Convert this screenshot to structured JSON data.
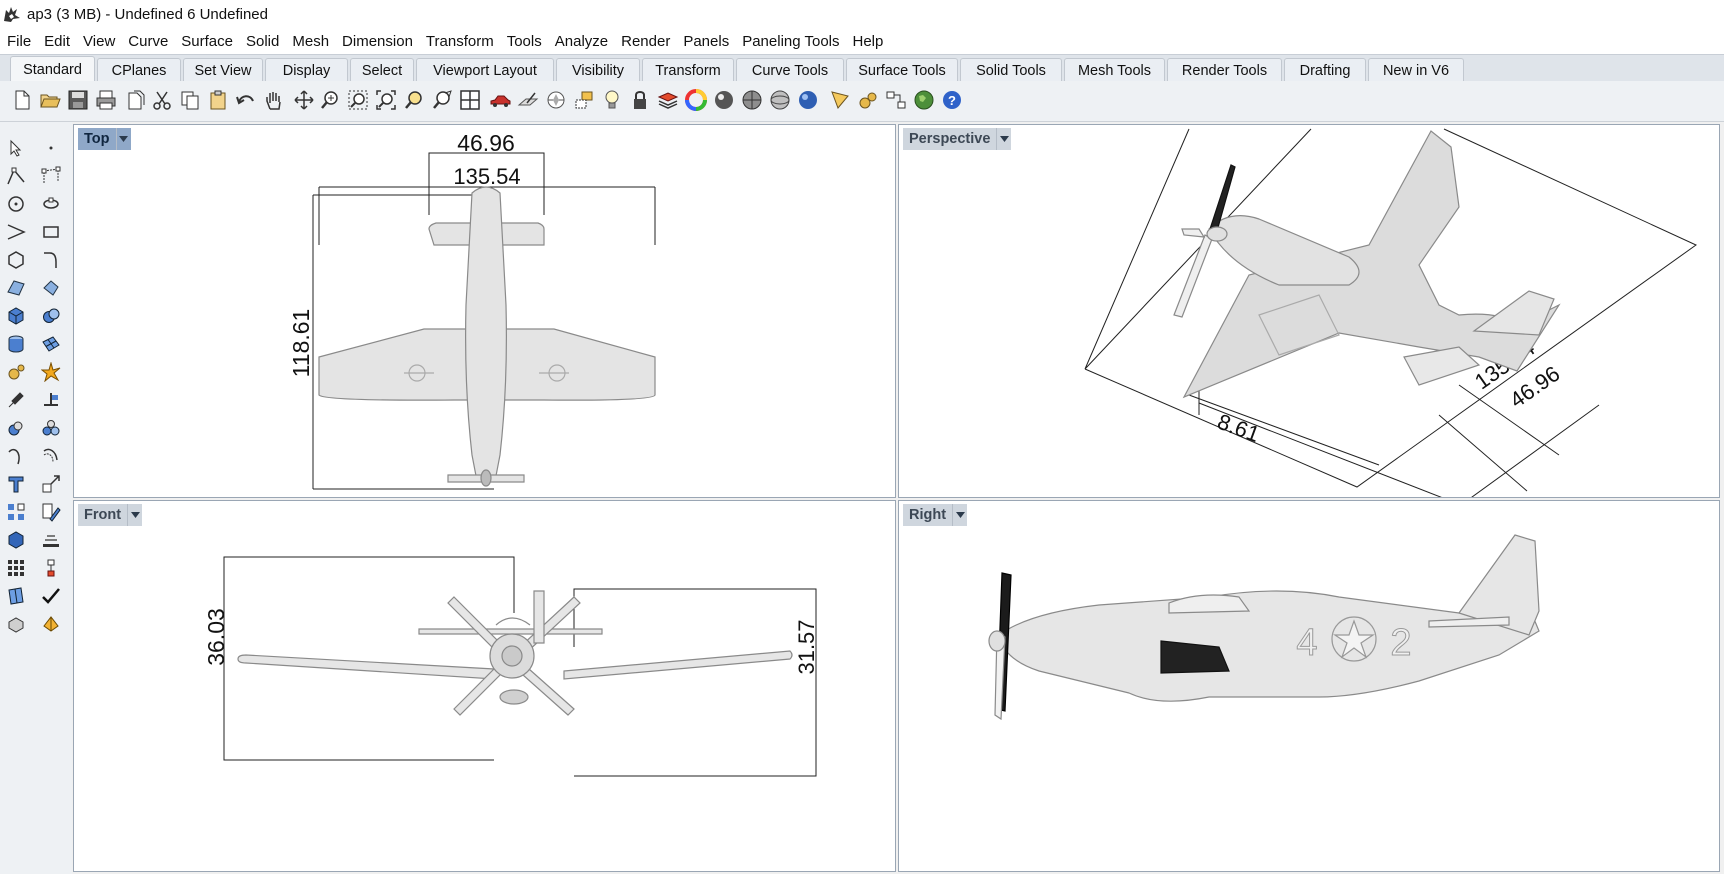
{
  "window": {
    "title": "ap3 (3 MB) - Undefined 6 Undefined"
  },
  "menu": [
    "File",
    "Edit",
    "View",
    "Curve",
    "Surface",
    "Solid",
    "Mesh",
    "Dimension",
    "Transform",
    "Tools",
    "Analyze",
    "Render",
    "Panels",
    "Paneling Tools",
    "Help"
  ],
  "tabs": [
    "Standard",
    "CPlanes",
    "Set View",
    "Display",
    "Select",
    "Viewport Layout",
    "Visibility",
    "Transform",
    "Curve Tools",
    "Surface Tools",
    "Solid Tools",
    "Mesh Tools",
    "Render Tools",
    "Drafting",
    "New in V6"
  ],
  "active_tab": "Standard",
  "toolbar_icons": [
    "new-icon",
    "open-icon",
    "save-icon",
    "print-icon",
    "import-icon",
    "cut-icon",
    "copy-icon",
    "paste-icon",
    "undo-icon",
    "pan-icon",
    "rotate-view-icon",
    "zoom-icon",
    "zoom-window-icon",
    "zoom-extents-icon",
    "zoom-selected-icon",
    "zoom-target-icon",
    "four-view-icon",
    "car-icon",
    "cplane-icon",
    "named-view-icon",
    "show-objects-icon",
    "light-icon",
    "lock-icon",
    "layer-icon",
    "color-wheel-icon",
    "render-sphere-icon",
    "shaded-sphere-icon",
    "ghosted-sphere-icon",
    "blue-sphere-icon",
    "properties-icon",
    "options-icon",
    "grasshopper-icon",
    "globe-icon",
    "help-icon"
  ],
  "left_tools": {
    "col1": [
      "select-arrow-icon",
      "polyline-icon",
      "circle-icon",
      "curve-icon",
      "polygon-icon",
      "surface-icon",
      "box-icon",
      "cylinder-icon",
      "gear-tool-icon",
      "transform-icon",
      "boolean-icon",
      "curve-tool-icon",
      "text-icon",
      "group-icon",
      "solid-box-icon",
      "grid-icon",
      "surface-blue-icon",
      "solid-shape-icon"
    ],
    "col2": [
      "point-icon",
      "control-points-icon",
      "rotate-points-icon",
      "rectangle-icon",
      "fillet-curve-icon",
      "sweep-icon",
      "union-icon",
      "mesh-surface-icon",
      "explode-icon",
      "split-icon",
      "spheres-icon",
      "offset-icon",
      "scale-icon",
      "edit-icon",
      "block-icon",
      "layout-icon",
      "check-icon",
      "cube-render-icon"
    ]
  },
  "viewports": {
    "top": {
      "label": "Top",
      "dims": {
        "d1": "46.96",
        "d2": "135.54",
        "d3": "118.61"
      }
    },
    "perspective": {
      "label": "Perspective",
      "dims": {
        "d1": "135.54",
        "d2": "46.96",
        "d3": "8.61"
      }
    },
    "front": {
      "label": "Front",
      "dims": {
        "d1": "36.03",
        "d2": "31.57"
      }
    },
    "right": {
      "label": "Right",
      "markings": {
        "left": "4",
        "right": "2"
      }
    }
  },
  "colors": {
    "active_viewport_label": "#8fa8c8",
    "inactive_viewport_label": "#cfd6de",
    "viewport_border": "#9aa6b4",
    "model_fill": "#e4e4e4",
    "model_stroke": "#8a8a8a",
    "dimension_line": "#222222"
  }
}
